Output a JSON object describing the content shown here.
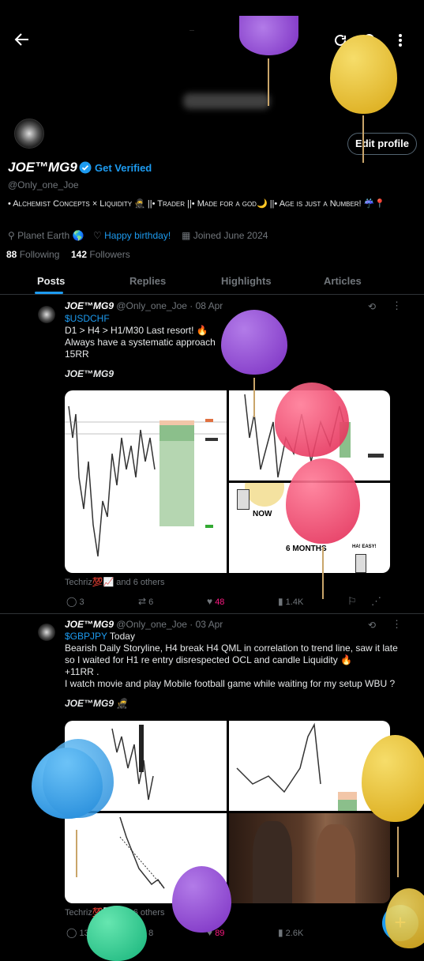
{
  "topbar": {
    "back_icon": "arrow-left-icon",
    "header_small": "—",
    "blurred_title": "",
    "refresh_icon": "refresh-icon",
    "search_icon": "search-icon",
    "more_icon": "more-vertical-icon"
  },
  "profile": {
    "display_name": "JOE™MG9",
    "verify_label": "Get Verified",
    "handle": "@Only_one_Joe",
    "bio": "• Alchemist Concepts × Liquidity 🥷 ||• Trader ||• Made for a god🌙 ||• Age is just a Number! ☔📍",
    "location": "Planet Earth 🌎",
    "birthday": "Happy birthday!",
    "joined": "Joined June 2024",
    "following_count": "88",
    "following_label": "Following",
    "followers_count": "142",
    "followers_label": "Followers",
    "edit_button": "Edit profile"
  },
  "tabs": [
    "Posts",
    "Replies",
    "Highlights",
    "Articles"
  ],
  "tweets": [
    {
      "name": "JOE™MG9",
      "handle": "@Only_one_Joe",
      "date": "· 08 Apr",
      "tag": "$USDCHF",
      "lines": [
        "D1 > H4 > H1/M30 Last resort! 🔥",
        "Always have a systematic approach",
        "15RR"
      ],
      "signature": "JOE™MG9",
      "meme_labels": {
        "now": "NOW",
        "later": "6 MONTHS",
        "easy": "HA! EASY!"
      },
      "liked_by": "Techriz💯📈 and 6 others",
      "replies": "3",
      "reposts": "6",
      "likes": "48",
      "views": "1.4K"
    },
    {
      "name": "JOE™MG9",
      "handle": "@Only_one_Joe",
      "date": "· 03 Apr",
      "tag": "$GBPJPY",
      "tag_suffix": " Today",
      "lines": [
        "Bearish Daily Storyline, H4 break H4 QML  in correlation to trend line, saw it late",
        "so I waited for H1 re entry disrespected OCL and candle Liquidity 🔥",
        "+11RR .",
        "I watch movie and play Mobile football game while waiting for my setup WBU ?"
      ],
      "signature": "JOE™MG9 🥷",
      "liked_by": "Techriz💯📈 and 6 others",
      "replies": "13",
      "reposts": "8",
      "likes": "89",
      "views": "2.6K"
    }
  ],
  "colors": {
    "accent": "#1d9bf0",
    "like": "#f91880",
    "background": "#000000"
  }
}
